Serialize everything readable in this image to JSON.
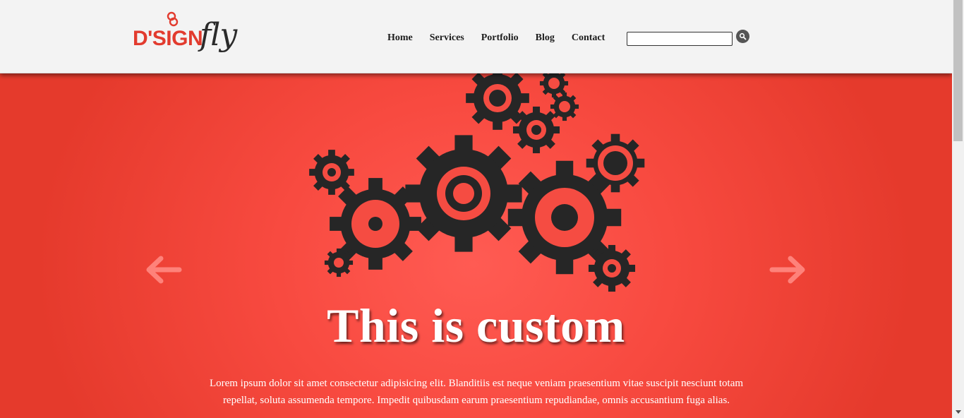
{
  "header": {
    "logo": {
      "main": "D'SIGN",
      "script": "fly"
    },
    "nav": {
      "home": "Home",
      "services": "Services",
      "portfolio": "Portfolio",
      "blog": "Blog",
      "contact": "Contact"
    },
    "search": {
      "value": "",
      "placeholder": ""
    }
  },
  "hero": {
    "title": "This is custom",
    "text": "Lorem ipsum dolor sit amet consectetur adipisicing elit. Blanditiis est neque veniam praesentium vitae suscipit nesciunt totam repellat, soluta assumenda tempore. Impedit quibusdam earum praesentium repudiandae, omnis accusantium fuga alias.",
    "icon": "gears-icon"
  },
  "colors": {
    "brand": "#e23b2e",
    "hero_background": "#f84a40",
    "gears": "#262626",
    "header_background": "#f3f3f3"
  }
}
